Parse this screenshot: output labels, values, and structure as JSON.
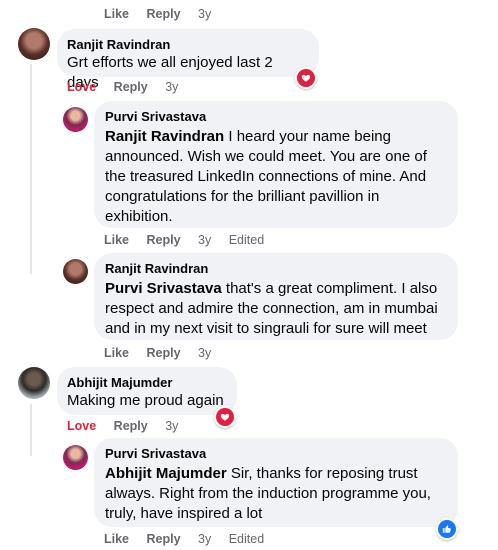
{
  "top_actions": {
    "like": "Like",
    "reply": "Reply",
    "time": "3y"
  },
  "comments": [
    {
      "author": "Ranjit Ravindran",
      "text": "Grt efforts we all enjoyed last 2 days",
      "actions": {
        "like": "Love",
        "reply": "Reply",
        "time": "3y"
      },
      "reaction": "love-icon",
      "replies": [
        {
          "author": "Purvi Srivastava",
          "mention": "Ranjit Ravindran",
          "lines": [
            " I heard your name being",
            "announced. Wish we could meet. You are one of",
            "the treasured LinkedIn connections of mine. And",
            "congratulations for the brilliant pavillion in",
            "exhibition."
          ],
          "actions": {
            "like": "Like",
            "reply": "Reply",
            "time": "3y",
            "edited": "Edited"
          }
        },
        {
          "author": "Ranjit Ravindran",
          "mention": "Purvi Srivastava",
          "lines": [
            " that's a great compliment. I also",
            "respect and admire the connection, am in mumbai",
            "and in my next visit to singrauli for sure will meet"
          ],
          "actions": {
            "like": "Like",
            "reply": "Reply",
            "time": "3y"
          }
        }
      ]
    },
    {
      "author": "Abhijit Majumder",
      "text": "Making me proud again",
      "actions": {
        "like": "Love",
        "reply": "Reply",
        "time": "3y"
      },
      "reaction": "love-icon",
      "replies": [
        {
          "author": "Purvi Srivastava",
          "mention": "Abhijit Majumder",
          "lines": [
            " Sir, thanks for reposing trust",
            "always. Right from the induction programme you,",
            "truly, have inspired a lot"
          ],
          "actions": {
            "like": "Like",
            "reply": "Reply",
            "time": "3y",
            "edited": "Edited"
          },
          "reaction": "like-icon"
        }
      ]
    }
  ],
  "colors": {
    "bubble": "#f0f2f5",
    "secondary_text": "#65676b",
    "love": "#e41e3f",
    "like": "#1877f2"
  }
}
